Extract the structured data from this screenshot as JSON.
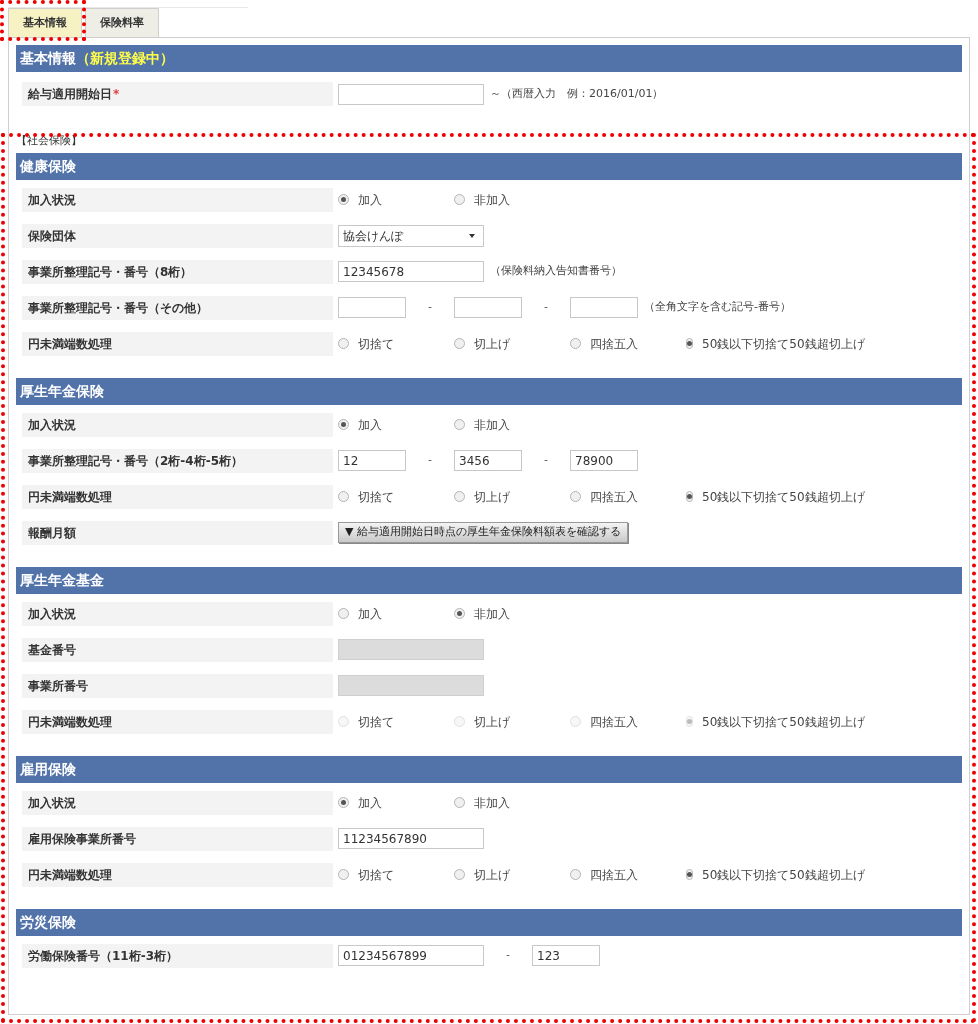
{
  "tabs": [
    {
      "label": "基本情報",
      "selected": true
    },
    {
      "label": "保険料率",
      "selected": false
    }
  ],
  "basic": {
    "title": "基本情報",
    "status": "（新規登録中）",
    "rows": [
      {
        "kind": "fields",
        "label": "給与適用開始日",
        "required_mark": "*",
        "items": [
          {
            "kind": "field",
            "disabled": false
          }
        ],
        "note": "～（西暦入力　例：2016/01/01）"
      }
    ]
  },
  "social_label": "【社会保険】",
  "sections": [
    {
      "title": "健康保険",
      "rows": [
        {
          "kind": "radio",
          "label": "加入状況",
          "disabled": false,
          "options": [
            {
              "label": "加入",
              "selected": true
            },
            {
              "label": "非加入",
              "selected": false
            }
          ]
        },
        {
          "kind": "select",
          "label": "保険団体",
          "value": "協会けんぽ"
        },
        {
          "kind": "fields",
          "label": "事業所整理記号・番号（8桁）",
          "items": [
            {
              "kind": "field",
              "value": "12345678",
              "disabled": false
            }
          ],
          "note": "（保険料納入告知書番号）"
        },
        {
          "kind": "fields",
          "label": "事業所整理記号・番号（その他）",
          "items": [
            {
              "kind": "field",
              "disabled": false
            },
            {
              "kind": "separator",
              "text": "-"
            },
            {
              "kind": "field",
              "disabled": false
            },
            {
              "kind": "separator",
              "text": "-"
            },
            {
              "kind": "field",
              "disabled": false
            }
          ],
          "note": "（全角文字を含む記号-番号）"
        },
        {
          "kind": "radio",
          "label": "円未満端数処理",
          "disabled": false,
          "options": [
            {
              "label": "切捨て",
              "selected": false
            },
            {
              "label": "切上げ",
              "selected": false
            },
            {
              "label": "四捨五入",
              "selected": false
            },
            {
              "label": "50銭以下切捨て50銭超切上げ",
              "selected": true
            }
          ]
        }
      ]
    },
    {
      "title": "厚生年金保険",
      "rows": [
        {
          "kind": "radio",
          "label": "加入状況",
          "disabled": false,
          "options": [
            {
              "label": "加入",
              "selected": true
            },
            {
              "label": "非加入",
              "selected": false
            }
          ]
        },
        {
          "kind": "fields",
          "label": "事業所整理記号・番号（2桁-4桁-5桁）",
          "items": [
            {
              "kind": "field",
              "value": "12",
              "disabled": false
            },
            {
              "kind": "separator",
              "text": "-"
            },
            {
              "kind": "field",
              "value": "3456",
              "disabled": false
            },
            {
              "kind": "separator",
              "text": "-"
            },
            {
              "kind": "field",
              "value": "78900",
              "disabled": false
            }
          ]
        },
        {
          "kind": "radio",
          "label": "円未満端数処理",
          "disabled": false,
          "options": [
            {
              "label": "切捨て",
              "selected": false
            },
            {
              "label": "切上げ",
              "selected": false
            },
            {
              "label": "四捨五入",
              "selected": false
            },
            {
              "label": "50銭以下切捨て50銭超切上げ",
              "selected": true
            }
          ]
        },
        {
          "kind": "button",
          "label": "報酬月額",
          "button": "▼ 給与適用開始日時点の厚生年金保険料額表を確認する"
        }
      ]
    },
    {
      "title": "厚生年金基金",
      "rows": [
        {
          "kind": "radio",
          "label": "加入状況",
          "disabled": false,
          "options": [
            {
              "label": "加入",
              "selected": false
            },
            {
              "label": "非加入",
              "selected": true
            }
          ]
        },
        {
          "kind": "fields",
          "label": "基金番号",
          "items": [
            {
              "kind": "field",
              "disabled": true
            }
          ]
        },
        {
          "kind": "fields",
          "label": "事業所番号",
          "items": [
            {
              "kind": "field",
              "disabled": true
            }
          ]
        },
        {
          "kind": "radio",
          "label": "円未満端数処理",
          "disabled": true,
          "options": [
            {
              "label": "切捨て",
              "selected": false
            },
            {
              "label": "切上げ",
              "selected": false
            },
            {
              "label": "四捨五入",
              "selected": false
            },
            {
              "label": "50銭以下切捨て50銭超切上げ",
              "selected": true
            }
          ]
        }
      ]
    },
    {
      "title": "雇用保険",
      "rows": [
        {
          "kind": "radio",
          "label": "加入状況",
          "disabled": false,
          "options": [
            {
              "label": "加入",
              "selected": true
            },
            {
              "label": "非加入",
              "selected": false
            }
          ]
        },
        {
          "kind": "fields",
          "label": "雇用保険事業所番号",
          "items": [
            {
              "kind": "field",
              "value": "11234567890",
              "disabled": false
            }
          ]
        },
        {
          "kind": "radio",
          "label": "円未満端数処理",
          "disabled": false,
          "options": [
            {
              "label": "切捨て",
              "selected": false
            },
            {
              "label": "切上げ",
              "selected": false
            },
            {
              "label": "四捨五入",
              "selected": false
            },
            {
              "label": "50銭以下切捨て50銭超切上げ",
              "selected": true
            }
          ]
        }
      ]
    },
    {
      "title": "労災保険",
      "rows": [
        {
          "kind": "fields",
          "label": "労働保険番号（11桁-3桁）",
          "items": [
            {
              "kind": "field",
              "value": "01234567899",
              "disabled": false
            },
            {
              "kind": "separator",
              "text": "-"
            },
            {
              "kind": "field",
              "value": "123",
              "disabled": false
            }
          ]
        }
      ]
    }
  ]
}
